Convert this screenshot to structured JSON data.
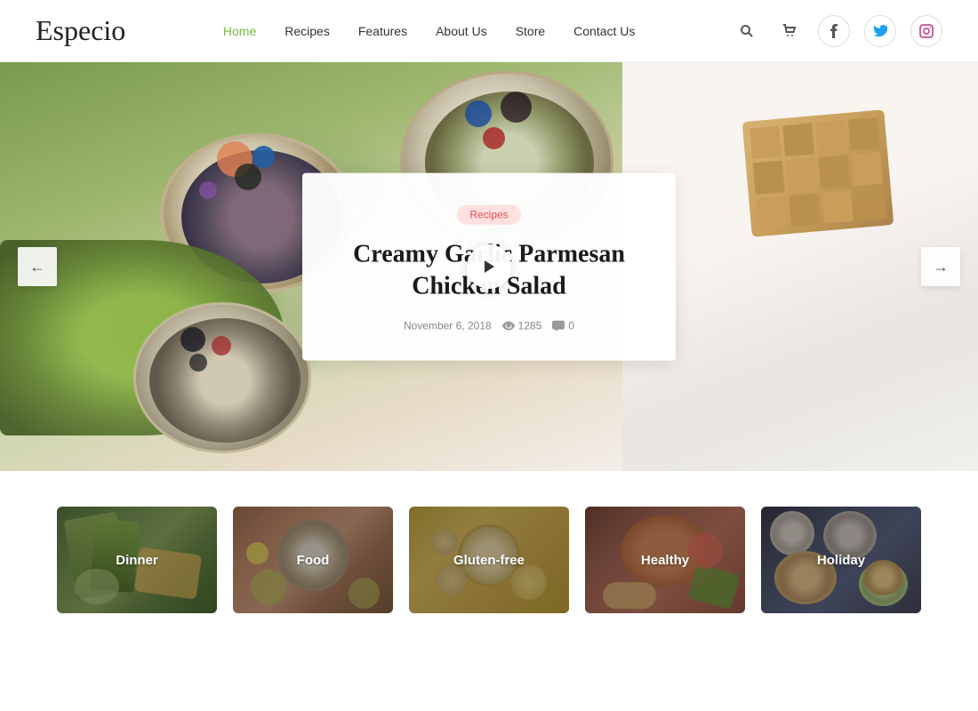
{
  "logo": "Especio",
  "nav": {
    "items": [
      {
        "label": "Home",
        "active": true
      },
      {
        "label": "Recipes",
        "active": false
      },
      {
        "label": "Features",
        "active": false
      },
      {
        "label": "About Us",
        "active": false
      },
      {
        "label": "Store",
        "active": false
      },
      {
        "label": "Contact Us",
        "active": false
      }
    ]
  },
  "social": {
    "facebook": "f",
    "twitter": "t",
    "instagram": "i"
  },
  "hero": {
    "tag": "Recipes",
    "title": "Creamy Garlic Parmesan Chicken Salad",
    "date": "November 6, 2018",
    "views": "1285",
    "comments": "0",
    "prev_label": "←",
    "next_label": "→"
  },
  "categories": [
    {
      "label": "Dinner",
      "theme": "dinner"
    },
    {
      "label": "Food",
      "theme": "food"
    },
    {
      "label": "Gluten-free",
      "theme": "gluten"
    },
    {
      "label": "Healthy",
      "theme": "healthy"
    },
    {
      "label": "Holiday",
      "theme": "holiday"
    }
  ]
}
